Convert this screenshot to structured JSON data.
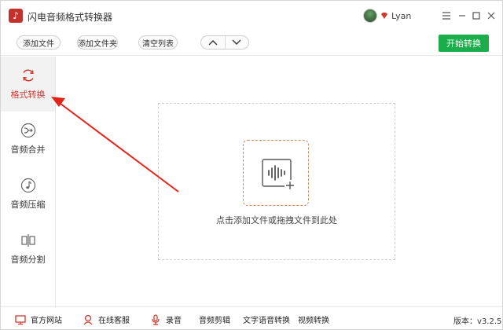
{
  "window": {
    "title": "闪电音频格式转换器",
    "user": {
      "name": "Lyan"
    }
  },
  "toolbar": {
    "add_file": "添加文件",
    "add_folder": "添加文件夹",
    "clear_list": "清空列表",
    "start": "开始转换"
  },
  "sidebar": {
    "items": [
      {
        "label": "格式转换",
        "icon": "refresh-icon",
        "active": true
      },
      {
        "label": "音频合并",
        "icon": "merge-icon",
        "active": false
      },
      {
        "label": "音频压缩",
        "icon": "note-icon",
        "active": false
      },
      {
        "label": "音频分割",
        "icon": "split-icon",
        "active": false
      }
    ]
  },
  "main": {
    "drop_hint": "点击添加文件或拖拽文件到此处"
  },
  "statusbar": {
    "items": [
      {
        "label": "官方网站",
        "icon": "monitor-icon"
      },
      {
        "label": "在线客服",
        "icon": "support-icon"
      },
      {
        "label": "录音",
        "icon": "mic-icon"
      },
      {
        "label": "音频剪辑",
        "icon": ""
      },
      {
        "label": "文字语音转换",
        "icon": ""
      },
      {
        "label": "视频转换",
        "icon": ""
      }
    ],
    "version": "版本：v3.2.5"
  },
  "colors": {
    "accent": "#d03a2f",
    "start_button": "#1aad4a",
    "drop_box_border": "#d48a5e"
  }
}
